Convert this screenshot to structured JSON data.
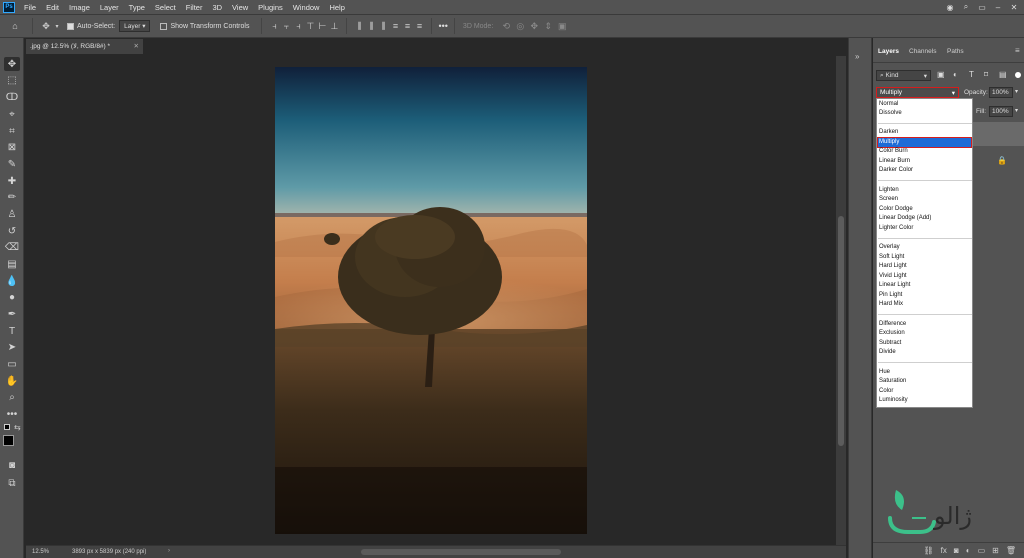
{
  "app": {
    "logo": "Ps"
  },
  "menu": [
    "File",
    "Edit",
    "Image",
    "Layer",
    "Type",
    "Select",
    "Filter",
    "3D",
    "View",
    "Plugins",
    "Window",
    "Help"
  ],
  "options_bar": {
    "auto_select_label": "Auto-Select:",
    "auto_select_value": "Layer",
    "show_transform_label": "Show Transform Controls",
    "mode_3d_label": "3D Mode:",
    "more_label": "•••"
  },
  "document": {
    "tab_title": "‏.jpg @ 12.5% (لا, RGB/8#) *",
    "zoom": "12.5%",
    "dimensions": "3893 px x 5839 px (240 ppi)"
  },
  "layers_panel": {
    "tabs": [
      "Layers",
      "Channels",
      "Paths"
    ],
    "filter_kind": "Kind",
    "blend_mode": "Multiply",
    "opacity_label": "Opacity:",
    "opacity_value": "100%",
    "fill_label": "Fill:",
    "fill_value": "100%"
  },
  "blend_modes": {
    "groups": [
      [
        "Normal",
        "Dissolve"
      ],
      [
        "Darken",
        "Multiply",
        "Color Burn",
        "Linear Burn",
        "Darker Color"
      ],
      [
        "Lighten",
        "Screen",
        "Color Dodge",
        "Linear Dodge (Add)",
        "Lighter Color"
      ],
      [
        "Overlay",
        "Soft Light",
        "Hard Light",
        "Vivid Light",
        "Linear Light",
        "Pin Light",
        "Hard Mix"
      ],
      [
        "Difference",
        "Exclusion",
        "Subtract",
        "Divide"
      ],
      [
        "Hue",
        "Saturation",
        "Color",
        "Luminosity"
      ]
    ],
    "selected": "Multiply"
  },
  "watermark": {
    "text": "ژالو"
  },
  "colors": {
    "ui_bg": "#535353",
    "canvas_bg": "#282828",
    "highlight": "#1e6bd6",
    "outline": "#d51d1d",
    "brand_green": "#3cc08a"
  }
}
